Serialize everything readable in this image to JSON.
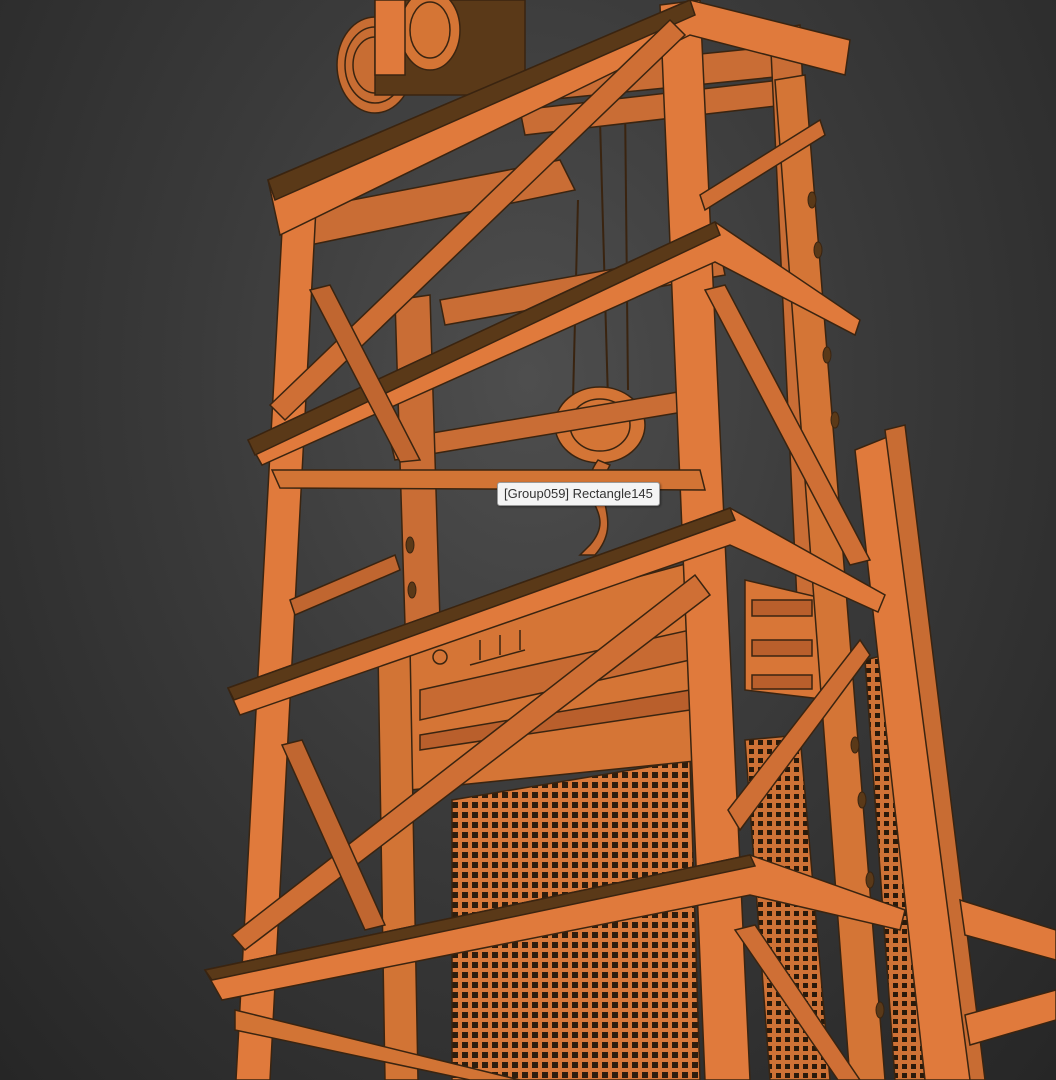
{
  "viewport": {
    "background_top": "#4e4e4e",
    "background_bottom": "#262626",
    "object_color": "#e07a3c",
    "object_shade": "#b85f2a",
    "edge_color": "#3a2410",
    "mesh_color": "#3c2712"
  },
  "hover_tooltip": {
    "label": "[Group059] Rectangle145"
  }
}
